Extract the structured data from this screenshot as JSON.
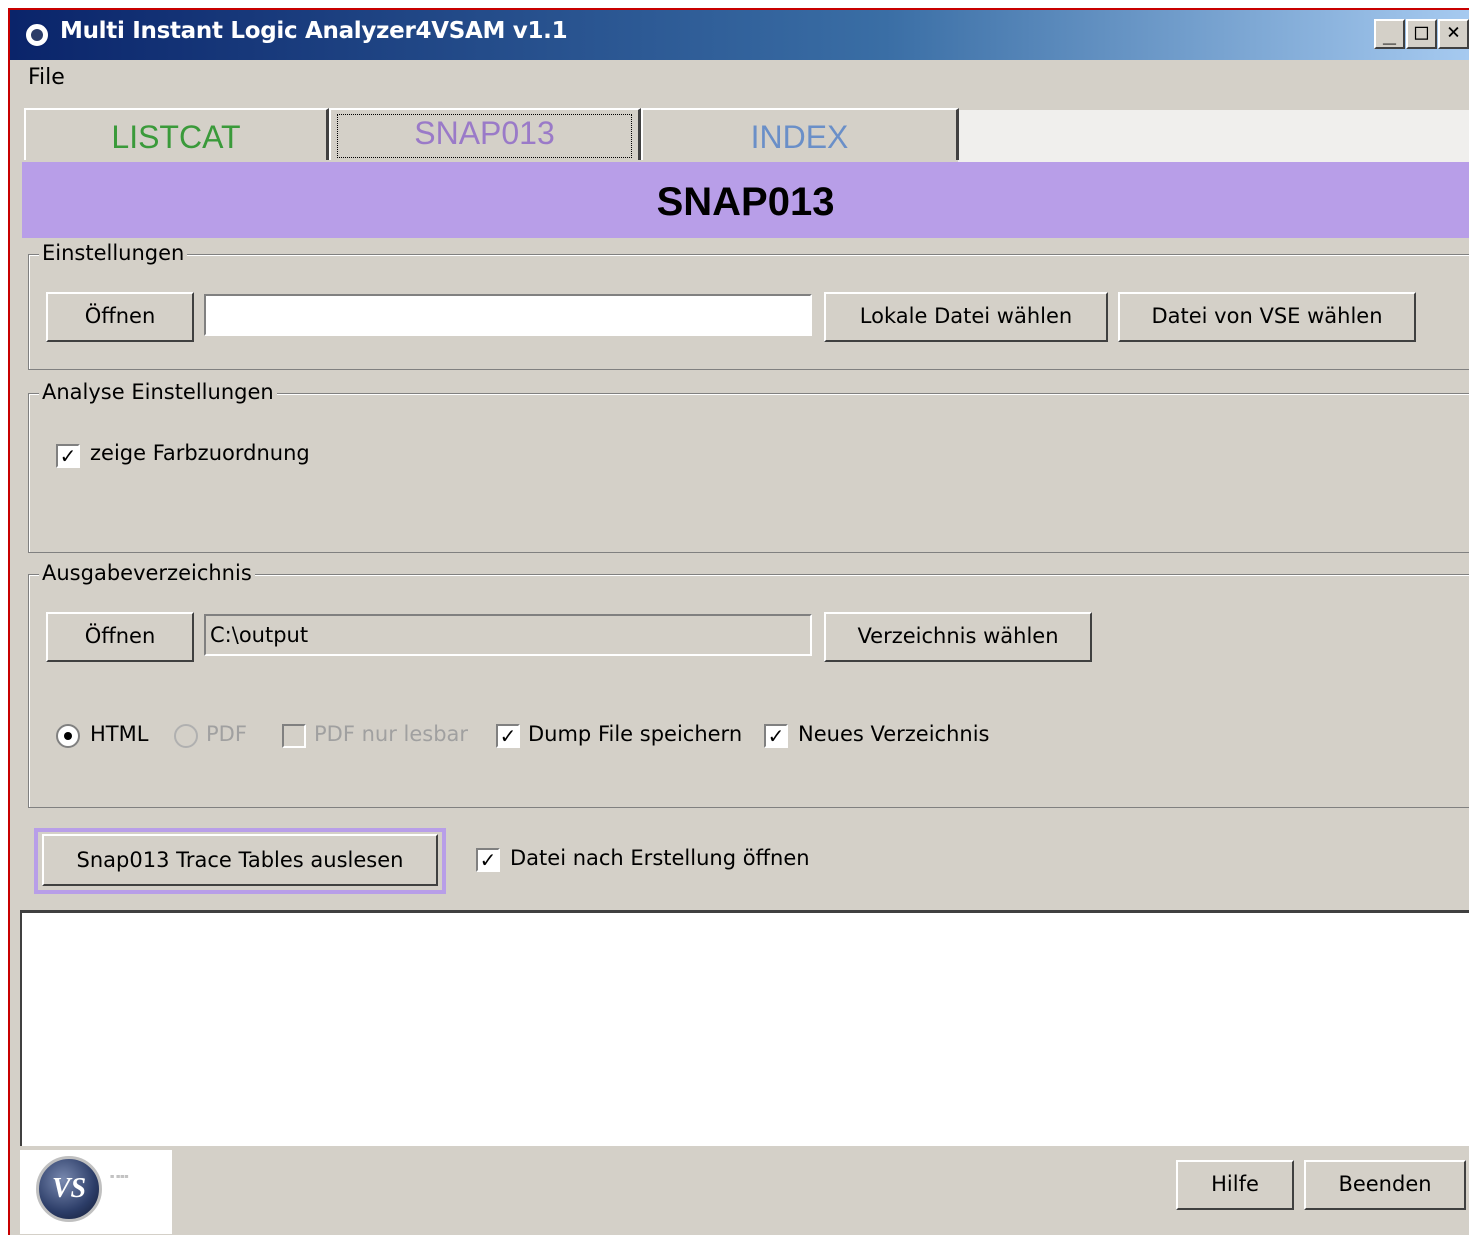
{
  "window": {
    "title": "Multi Instant Logic Analyzer4VSAM v1.1"
  },
  "menu": {
    "file": "File"
  },
  "tabs": {
    "listcat": "LISTCAT",
    "snap": "SNAP013",
    "index": "INDEX"
  },
  "banner": {
    "title": "SNAP013"
  },
  "einstellungen": {
    "legend": "Einstellungen",
    "open_button": "Öffnen",
    "file_value": "",
    "local_button": "Lokale Datei wählen",
    "vse_button": "Datei von VSE wählen"
  },
  "analyse": {
    "legend": "Analyse Einstellungen",
    "color_label": "zeige Farbzuordnung",
    "color_checked": true
  },
  "ausgabe": {
    "legend": "Ausgabeverzeichnis",
    "open_button": "Öffnen",
    "dir_value": "C:\\output",
    "choose_button": "Verzeichnis wählen",
    "html_label": "HTML",
    "pdf_label": "PDF",
    "pdf_readonly_label": "PDF nur lesbar",
    "dump_label": "Dump File speichern",
    "newdir_label": "Neues Verzeichnis"
  },
  "action": {
    "read_button": "Snap013 Trace Tables auslesen",
    "open_after_label": "Datei nach Erstellung öffnen"
  },
  "footer": {
    "help_button": "Hilfe",
    "exit_button": "Beenden",
    "logo_text": "VS"
  },
  "colors": {
    "banner": "#b89ee8",
    "listcat": "#3a9a3a",
    "snap": "#9a7ac8",
    "index": "#6a8fc8"
  }
}
